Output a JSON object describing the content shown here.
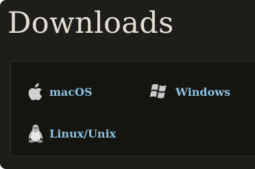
{
  "panel": {
    "title": "Downloads"
  },
  "downloads": [
    {
      "label": "macOS",
      "icon": "apple-icon"
    },
    {
      "label": "Windows",
      "icon": "windows-icon"
    },
    {
      "label": "Linux/Unix",
      "icon": "tux-penguin-icon"
    }
  ],
  "colors": {
    "panel_bg": "#1d1d1a",
    "inner_bg": "#141411",
    "title_text": "#e4ded2",
    "link_text": "#8dc2e0",
    "icon": "#d0d0d0"
  }
}
